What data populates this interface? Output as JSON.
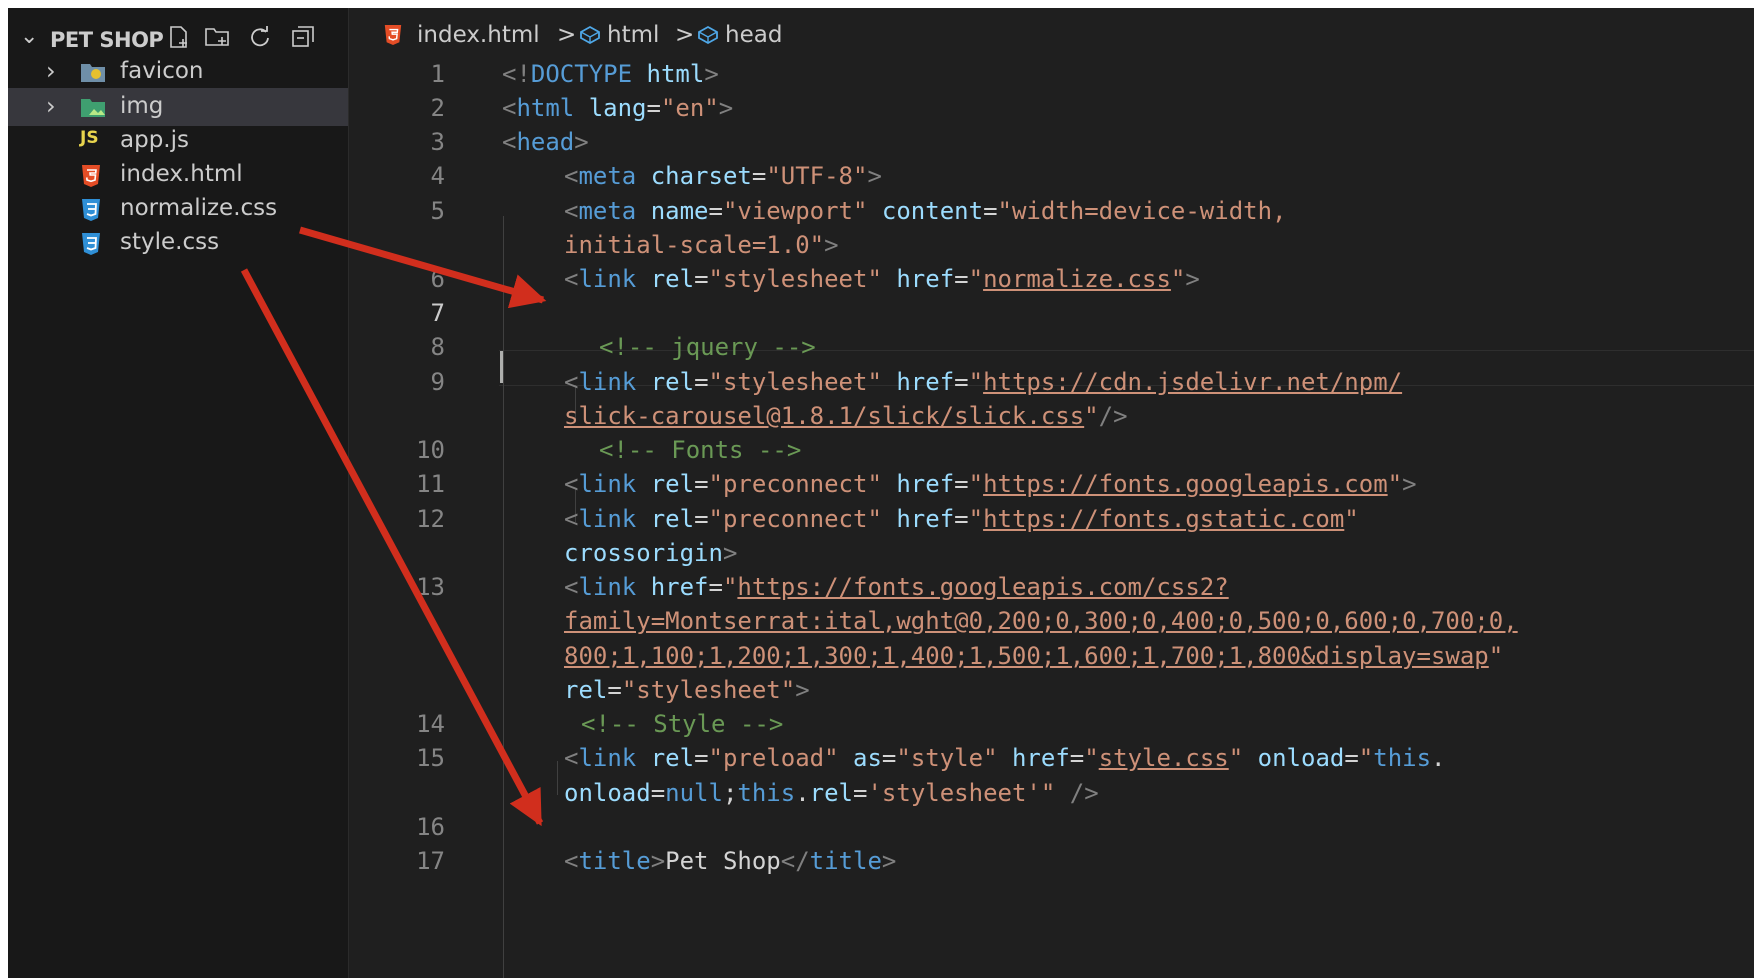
{
  "explorer": {
    "title": "PET SHOP",
    "items": [
      {
        "label": "favicon",
        "kind": "folder"
      },
      {
        "label": "img",
        "kind": "folder"
      },
      {
        "label": "app.js",
        "kind": "js"
      },
      {
        "label": "index.html",
        "kind": "html"
      },
      {
        "label": "normalize.css",
        "kind": "css"
      },
      {
        "label": "style.css",
        "kind": "css"
      }
    ],
    "icons": [
      "new-file-icon",
      "new-folder-icon",
      "refresh-icon",
      "collapse-all-icon"
    ]
  },
  "breadcrumb": {
    "file": "index.html",
    "sep": ">",
    "item1": "html",
    "item2": "head"
  },
  "editor": {
    "line_numbers": [
      "1",
      "2",
      "3",
      "4",
      "5",
      "6",
      "7",
      "8",
      "9",
      "10",
      "11",
      "12",
      "13",
      "14",
      "15",
      "16",
      "17"
    ],
    "current_line": "7",
    "lines": {
      "l1": {
        "open": "<!",
        "tag": "DOCTYPE",
        "attr": "html",
        "close": ">"
      },
      "l2": {
        "open": "<",
        "tag": "html",
        "attr": "lang",
        "eq": "=",
        "val": "\"en\"",
        "close": ">"
      },
      "l3": {
        "open": "<",
        "tag": "head",
        "close": ">"
      },
      "l4": {
        "open": "<",
        "tag": "meta",
        "attr": "charset",
        "eq": "=",
        "val": "\"UTF-8\"",
        "close": ">"
      },
      "l5": {
        "open": "<",
        "tag": "meta",
        "attr1": "name",
        "eq": "=",
        "val1": "\"viewport\"",
        "attr2": "content",
        "val2": "\"width=device-width,",
        "wrap": "initial-scale=1.0\"",
        "close": ">"
      },
      "l6": {
        "open": "<",
        "tag": "link",
        "attr1": "rel",
        "eq": "=",
        "val1": "\"stylesheet\"",
        "attr2": "href",
        "q": "\"",
        "url": "normalize.css",
        "close": ">"
      },
      "l8": {
        "comment": "<!-- jquery -->"
      },
      "l9": {
        "open": "<",
        "tag": "link",
        "attr1": "rel",
        "eq": "=",
        "val1": "\"stylesheet\"",
        "attr2": "href",
        "q": "\"",
        "url1": "https://cdn.jsdelivr.net/npm/",
        "url2": "slick-carousel@1.8.1/slick/slick.css",
        "close": "/>"
      },
      "l10": {
        "comment": "<!-- Fonts -->"
      },
      "l11": {
        "open": "<",
        "tag": "link",
        "attr1": "rel",
        "eq": "=",
        "val1": "\"preconnect\"",
        "attr2": "href",
        "q": "\"",
        "url": "https://fonts.googleapis.com",
        "close": ">"
      },
      "l12": {
        "open": "<",
        "tag": "link",
        "attr1": "rel",
        "eq": "=",
        "val1": "\"preconnect\"",
        "attr2": "href",
        "q": "\"",
        "url": "https://fonts.gstatic.com",
        "attr3": "crossorigin",
        "close": ">"
      },
      "l13": {
        "open": "<",
        "tag": "link",
        "attr1": "href",
        "eq": "=",
        "q": "\"",
        "url1": "https://fonts.googleapis.com/css2?",
        "url2": "family=Montserrat:ital,wght@0,200;0,300;0,400;0,500;0,600;0,700;0,",
        "url3": "800;1,100;1,200;1,300;1,400;1,500;1,600;1,700;1,800&display=swap",
        "attr2": "rel",
        "val2": "\"stylesheet\"",
        "close": ">"
      },
      "l14": {
        "comment": "<!-- Style -->"
      },
      "l15": {
        "open": "<",
        "tag": "link",
        "attr1": "rel",
        "eq": "=",
        "val1": "\"preload\"",
        "attr2": "as",
        "val2": "\"style\"",
        "attr3": "href",
        "q": "\"",
        "url": "style.css",
        "attr4": "onload",
        "str1": "\"",
        "kw1": "this",
        "dot1": ".",
        "prop1": "onload",
        "kw2": "null",
        "semi": ";",
        "kw3": "this",
        "dot2": ".",
        "prop2": "rel",
        "str2": "'stylesheet'\"",
        "close": "/>"
      },
      "l17": {
        "open": "<",
        "tag": "title",
        "close": ">",
        "text": "Pet Shop",
        "open2": "</",
        "tag2": "title",
        "close2": ">"
      }
    }
  },
  "annotation_color": "#d12e1d"
}
